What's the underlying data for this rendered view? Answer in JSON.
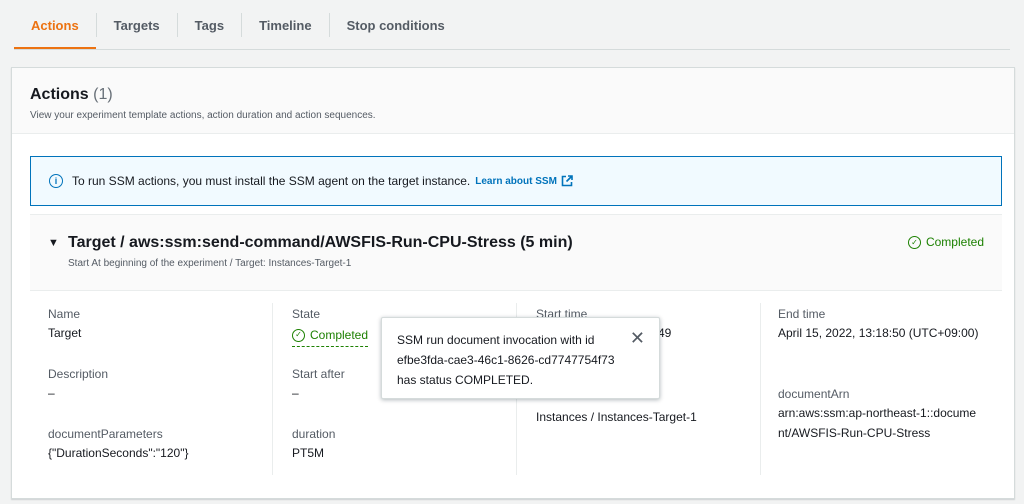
{
  "tabs": [
    {
      "label": "Actions",
      "active": true
    },
    {
      "label": "Targets"
    },
    {
      "label": "Tags"
    },
    {
      "label": "Timeline"
    },
    {
      "label": "Stop conditions"
    }
  ],
  "panel": {
    "title": "Actions",
    "count": "(1)",
    "description": "View your experiment template actions, action duration and action sequences."
  },
  "alert": {
    "text": "To run SSM actions, you must install the SSM agent on the target instance.",
    "link": "Learn about SSM"
  },
  "action": {
    "title": "Target / aws:ssm:send-command/AWSFIS-Run-CPU-Stress (5 min)",
    "subtitle": "Start At beginning of the experiment / Target: Instances-Target-1",
    "status": "Completed",
    "fields": {
      "name_label": "Name",
      "name_value": "Target",
      "description_label": "Description",
      "description_value": "–",
      "docparams_label": "documentParameters",
      "docparams_value": "{\"DurationSeconds\":\"120\"}",
      "state_label": "State",
      "state_value": "Completed",
      "start_after_label": "Start after",
      "start_after_value": "–",
      "duration_label": "duration",
      "duration_value": "PT5M",
      "start_time_label": "Start time",
      "start_time_partial": "49",
      "targets_value": "Instances / Instances-Target-1",
      "end_time_label": "End time",
      "end_time_value": "April 15, 2022, 13:18:50 (UTC+09:00)",
      "document_arn_label": "documentArn",
      "document_arn_value": "arn:aws:ssm:ap-northeast-1::document/AWSFIS-Run-CPU-Stress"
    }
  },
  "popover": {
    "text": "SSM run document invocation with id efbe3fda-cae3-46c1-8626-cd7747754f73 has status COMPLETED."
  },
  "colors": {
    "accent": "#ec7211",
    "link": "#0073bb",
    "success": "#1d8102"
  }
}
